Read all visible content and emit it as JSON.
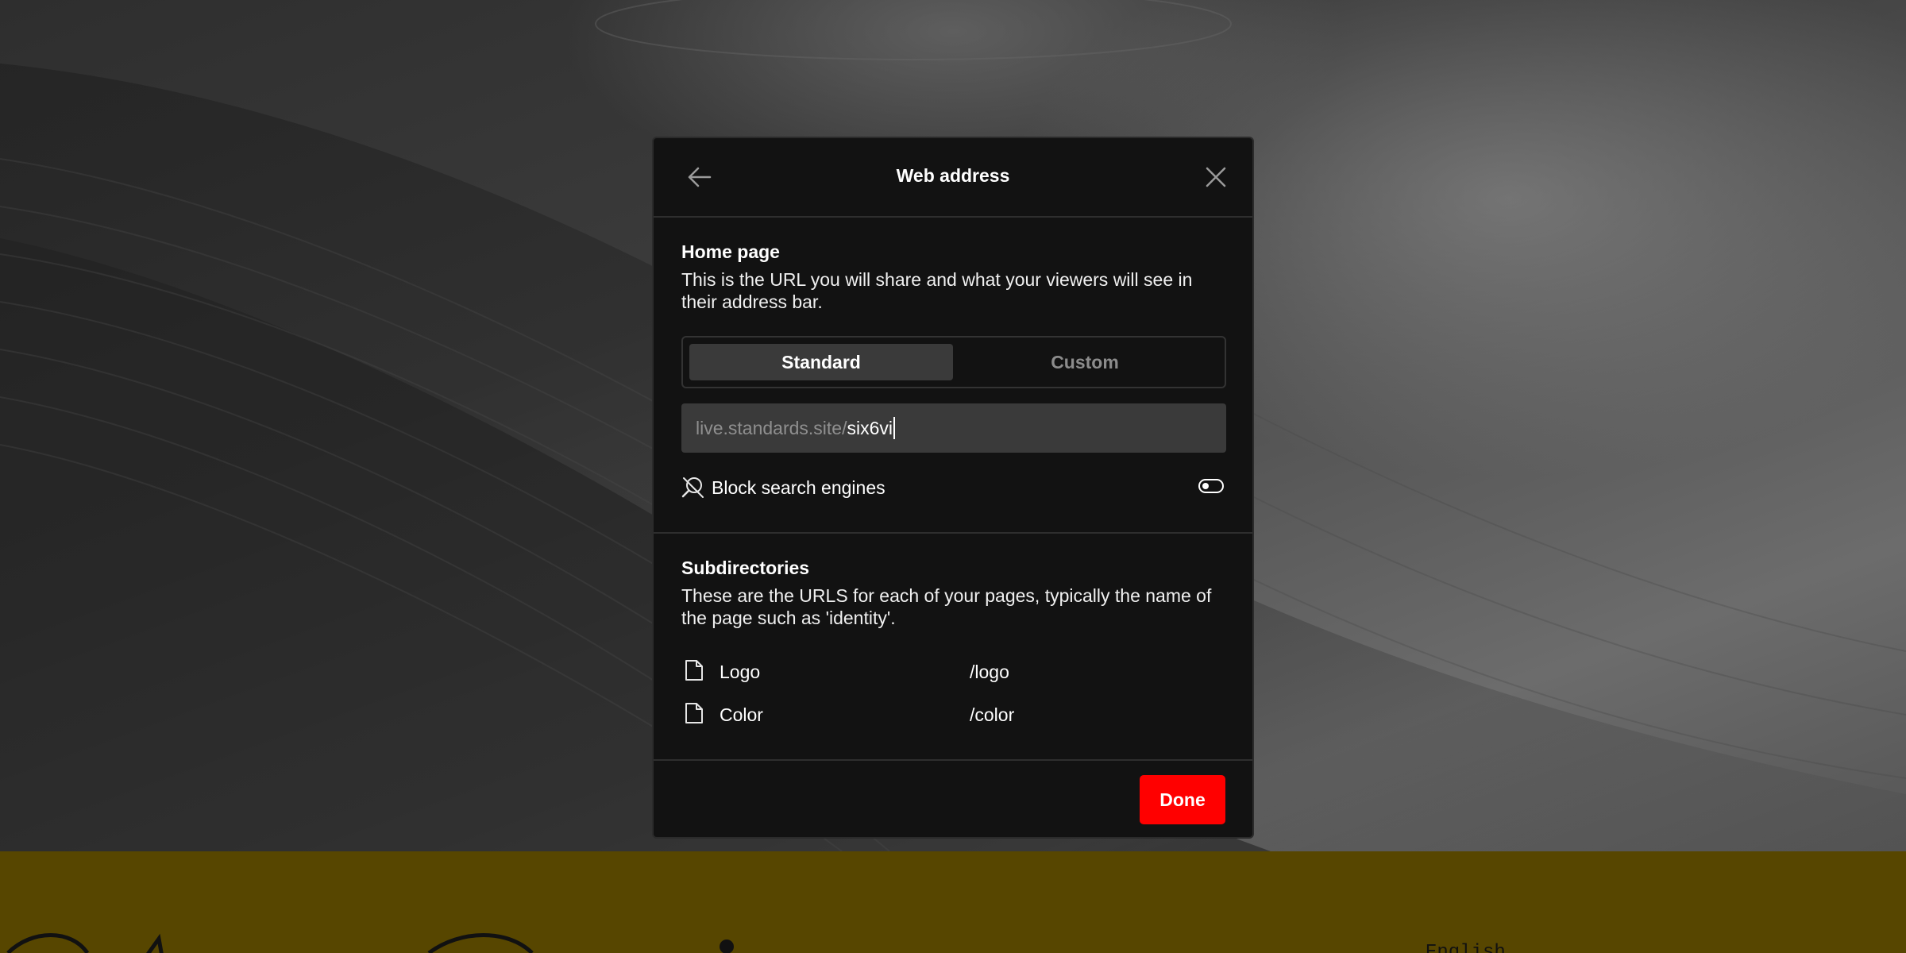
{
  "modal": {
    "title": "Web address",
    "home_page": {
      "title": "Home page",
      "description": "This is the URL you will share and what your viewers will see in their address bar.",
      "tabs": [
        {
          "label": "Standard",
          "selected": true
        },
        {
          "label": "Custom",
          "selected": false
        }
      ],
      "url_prefix": "live.standards.site/",
      "url_value": "six6vi",
      "block_search_engines": {
        "label": "Block search engines",
        "enabled": false
      }
    },
    "subdirectories": {
      "title": "Subdirectories",
      "description": "These are the URLS for each of your pages, typically the name of the page such as 'identity'.",
      "items": [
        {
          "name": "Logo",
          "path": "/logo"
        },
        {
          "name": "Color",
          "path": "/color"
        }
      ]
    },
    "done_label": "Done"
  },
  "footer_band": {
    "language": "English"
  },
  "colors": {
    "modal_bg": "#121212",
    "accent_red": "#ff0000",
    "band_olive": "#574600"
  },
  "icons": [
    "arrow-left-icon",
    "close-icon",
    "search-off-icon",
    "file-icon"
  ]
}
